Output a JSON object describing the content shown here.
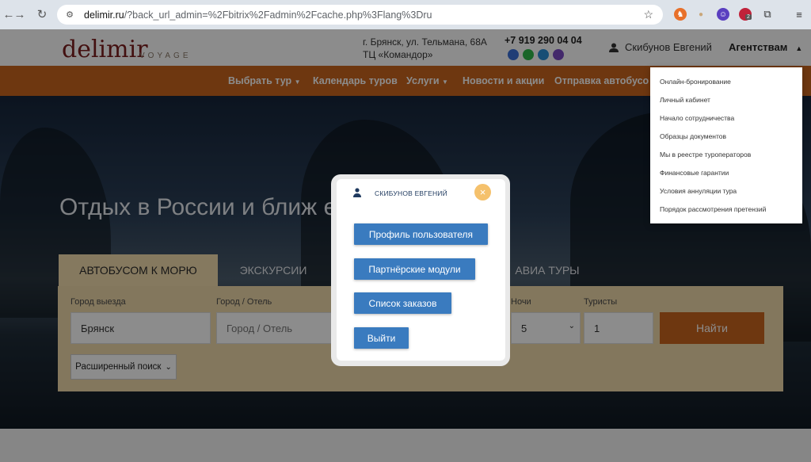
{
  "browser": {
    "url_host": "delimir.ru",
    "url_path": "/?back_url_admin=%2Fbitrix%2Fadmin%2Fcache.php%3Flang%3Dru",
    "ext_badge": "2"
  },
  "header": {
    "logo": "delimir",
    "logo_sub": "VOYAGE",
    "address_line1": "г. Брянск, ул. Тельмана, 68А",
    "address_line2": "ТЦ «Командор»",
    "phone": "+7 919 290 04 04",
    "user_name": "Скибунов Евгений",
    "agency_label": "Агентствам"
  },
  "nav": {
    "items": [
      "Выбрать тур",
      "Календарь туров",
      "Услуги",
      "Новости и акции",
      "Отправка автобусо"
    ]
  },
  "hero": {
    "title": "Отдых в России и ближ                           ежье",
    "tabs": [
      "АВТОБУСОМ К МОРЮ",
      "ЭКСКУРСИИ",
      "АВИА ТУРЫ"
    ]
  },
  "search": {
    "from_label": "Город выезда",
    "from_value": "Брянск",
    "city_label": "Город / Отель",
    "city_placeholder": "Город / Отель",
    "nights_label": "Ночи",
    "nights_value": "5",
    "tourists_label": "Туристы",
    "tourists_value": "1",
    "find_button": "Найти",
    "advanced_button": "Расширенный поиск"
  },
  "dropdown": {
    "items": [
      "Онлайн-бронирование",
      "Личный кабинет",
      "Начало сотрудничества",
      "Образцы документов",
      "Мы в реестре туроператоров",
      "Финансовые гарантии",
      "Условия аннуляции тура",
      "Порядок рассмотрения претензий"
    ]
  },
  "modal": {
    "user_name": "Скибунов Евгений",
    "close_icon": "×",
    "buttons": [
      "Профиль пользователя",
      "Партнёрские модули",
      "Список заказов",
      "Выйти"
    ]
  },
  "colors": {
    "accent_orange": "#c8641e",
    "modal_button_blue": "#3a7bbf",
    "close_yellow": "#f5c16c"
  }
}
